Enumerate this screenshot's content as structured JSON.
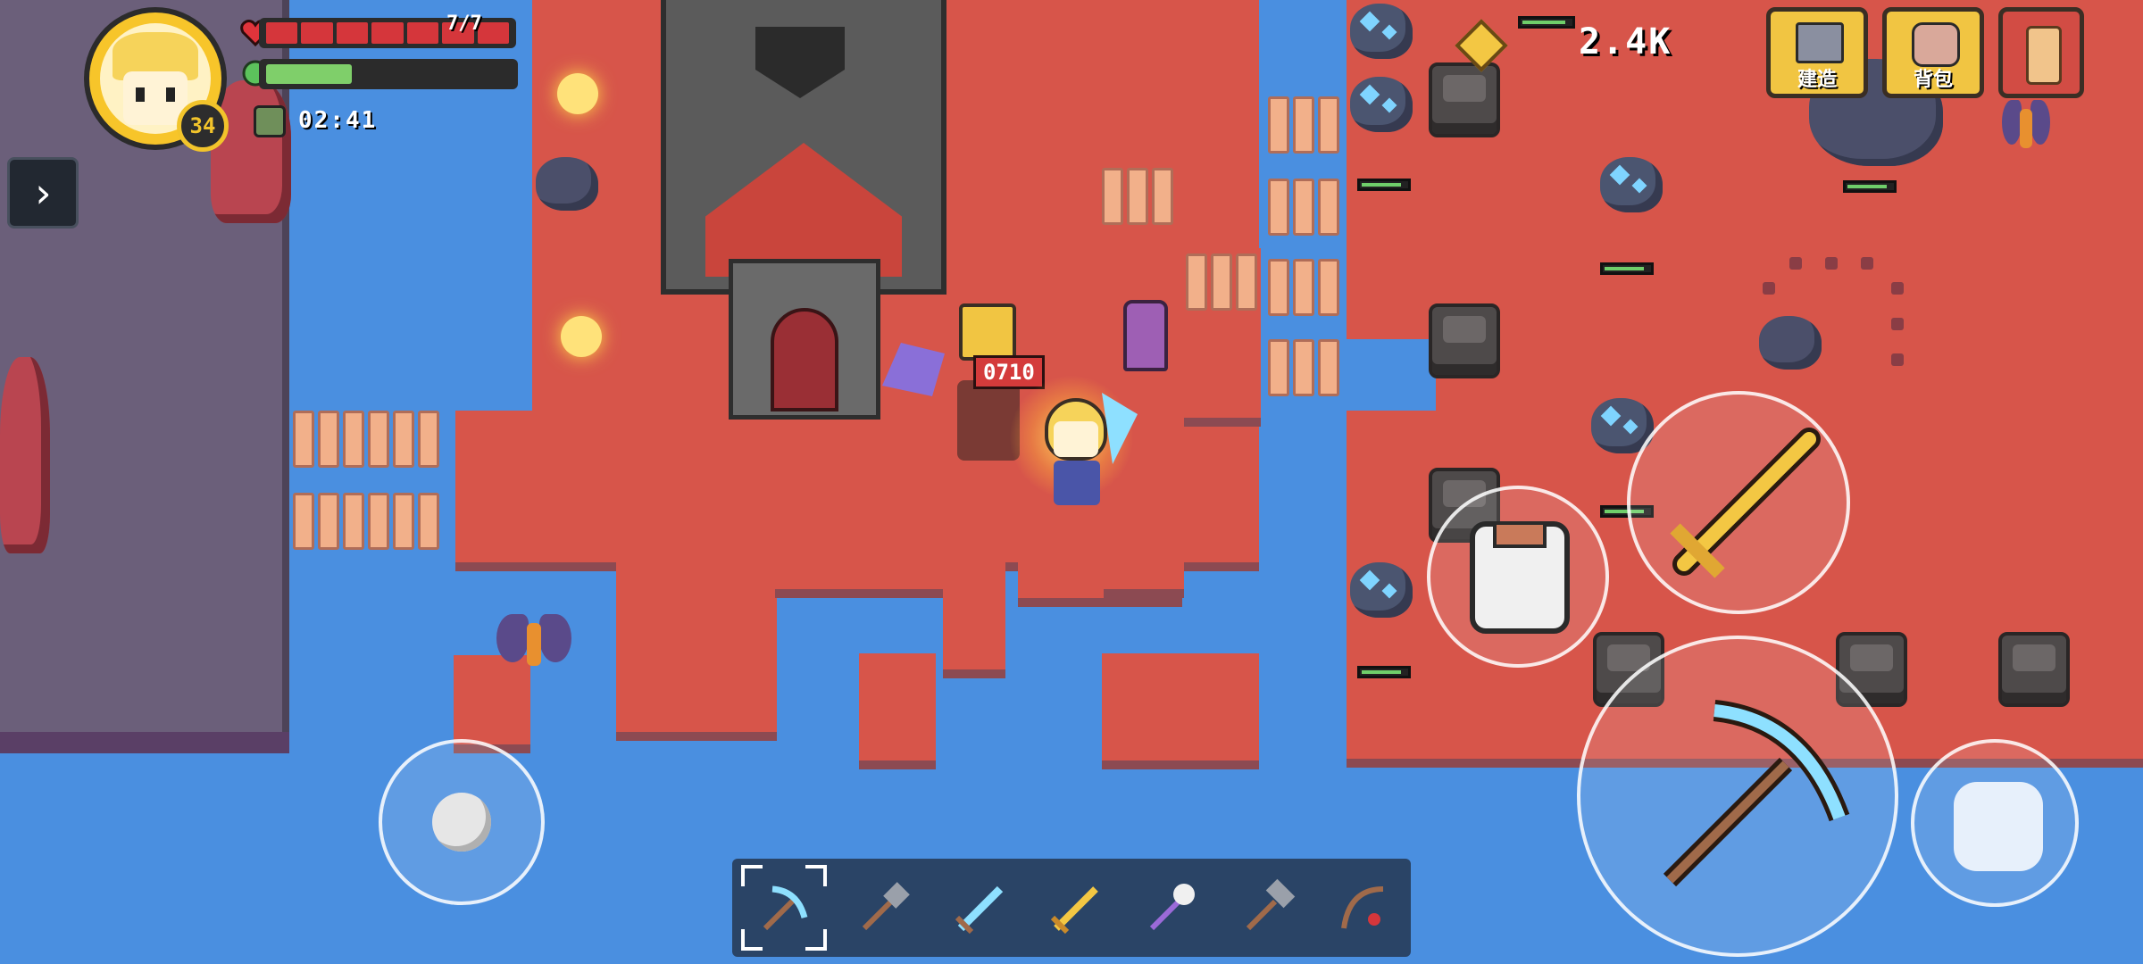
{
  "player": {
    "level": "34",
    "hp_text": "7/7",
    "hp_segments": 7,
    "energy_fraction": 0.35,
    "timer": "02:41"
  },
  "resources": {
    "coins": "2.4K"
  },
  "top_buttons": {
    "build_label": "建造",
    "backpack_label": "背包",
    "quest_icon": "scroll-icon"
  },
  "combat": {
    "damage_popup": "0710"
  },
  "hotbar": {
    "slots": [
      "pickaxe-icon",
      "shovel-icon",
      "sword-icon",
      "golden-sword-icon",
      "skull-staff-icon",
      "hammer-icon",
      "fishing-rod-icon"
    ],
    "selected_index": 0
  },
  "actions": {
    "attack_icon": "golden-sword-icon",
    "potion_icon": "potion-icon",
    "tool_icon": "pickaxe-icon",
    "swap_icon": "swap-icon"
  },
  "colors": {
    "ground": "#d7554a",
    "water": "#4a8fe0",
    "hp": "#d5363b",
    "energy": "#7fcf6a",
    "gold": "#f2c42b"
  }
}
